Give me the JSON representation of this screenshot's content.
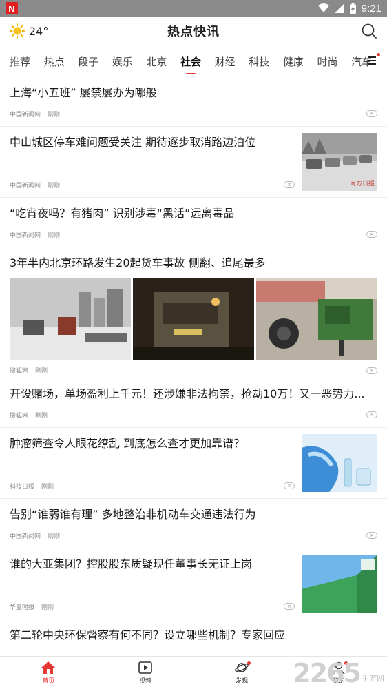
{
  "statusbar": {
    "app_letter": "N",
    "time": "9:21"
  },
  "header": {
    "temperature": "24°",
    "title": "热点快讯"
  },
  "tabs": [
    "推荐",
    "热点",
    "段子",
    "娱乐",
    "北京",
    "社会",
    "财经",
    "科技",
    "健康",
    "时尚",
    "汽车"
  ],
  "active_tab": "社会",
  "feed": [
    {
      "headline": "上海“小五班” 屡禁屡办为哪般",
      "source": "中国新闻网",
      "time": "刚刚"
    },
    {
      "headline": "中山城区停车难问题受关注 期待逐步取消路边泊位",
      "source": "中国新闻网",
      "time": "刚刚",
      "image_caption": "南方日报"
    },
    {
      "headline": "“吃宵夜吗？有猪肉” 识别涉毒“黑话”远离毒品",
      "source": "中国新闻网",
      "time": "刚刚"
    },
    {
      "headline": "3年半内北京环路发生20起货车事故 侧翻、追尾最多",
      "source": "搜狐网",
      "time": "刚刚"
    },
    {
      "headline": "开设赌场，单场盈利上千元！还涉嫌非法拘禁，抢劫10万！又一恶势力...",
      "source": "搜狐网",
      "time": "刚刚"
    },
    {
      "headline": "肿瘤筛查令人眼花缭乱 到底怎么查才更加靠谱？",
      "source": "科技日报",
      "time": "刚刚"
    },
    {
      "headline": "告别“谁弱谁有理” 多地整治非机动车交通违法行为",
      "source": "中国新闻网",
      "time": "刚刚"
    },
    {
      "headline": "谁的大亚集团？控股股东质疑现任董事长无证上岗",
      "source": "华夏时报",
      "time": "刚刚"
    },
    {
      "headline": "第二轮中央环保督察有何不同？设立哪些机制？专家回应"
    }
  ],
  "close_glyph": "×",
  "bottomnav": {
    "home": "首页",
    "video": "视频",
    "discover": "发现",
    "mine": "我的"
  },
  "watermark": {
    "number": "2265",
    "text": "手游网"
  },
  "colors": {
    "accent": "#e53935",
    "statusbar": "#8a8a8a"
  }
}
